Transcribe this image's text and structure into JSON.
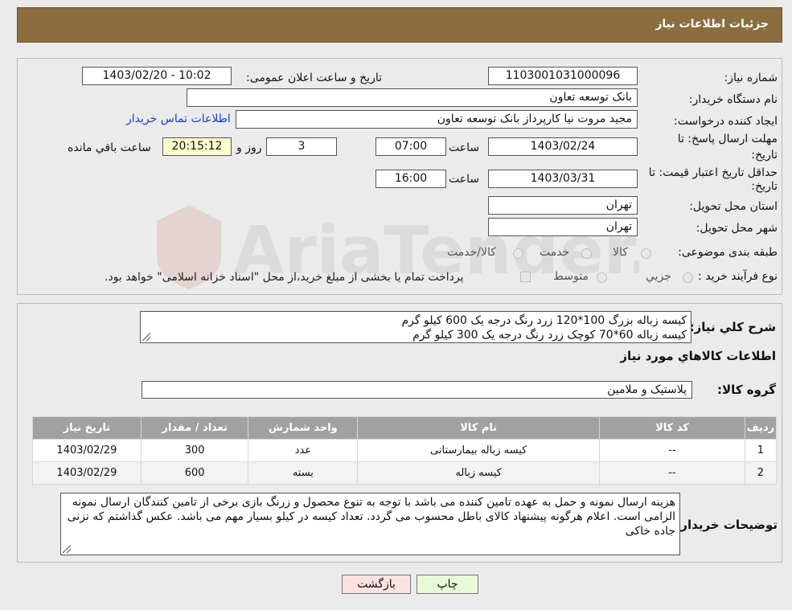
{
  "header": {
    "title": "جزئیات اطلاعات نیاز"
  },
  "fields": {
    "need_number_label": "شماره نیاز:",
    "need_number": "1103001031000096",
    "announce_label": "تاریخ و ساعت اعلان عمومی:",
    "announce_value": "1403/02/20 - 10:02",
    "buyer_org_label": "نام دستگاه خریدار:",
    "buyer_org": "بانک توسعه تعاون",
    "requester_label": "ایجاد کننده درخواست:",
    "requester": "مجید مروت نیا کارپرداز بانک توسعه تعاون",
    "buyer_contact_link": "اطلاعات تماس خریدار",
    "deadline_label_1": "مهلت ارسال پاسخ: تا",
    "deadline_label_2": "تاریخ:",
    "deadline_date": "1403/02/24",
    "time_label": "ساعت",
    "deadline_time": "07:00",
    "days_value": "3",
    "days_label": "روز و",
    "remaining_time": "20:15:12",
    "remaining_label": "ساعت باقي مانده",
    "validity_label_1": "حداقل تاریخ اعتبار قیمت: تا",
    "validity_label_2": "تاریخ:",
    "validity_date": "1403/03/31",
    "validity_time": "16:00",
    "province_label": "استان محل تحویل:",
    "province": "تهران",
    "city_label": "شهر محل تحویل:",
    "city": "تهران",
    "category_label": "طبقه بندی موضوعی:",
    "category_options": [
      "کالا",
      "خدمت",
      "کالا/خدمت"
    ],
    "purchase_type_label": "نوع فرآیند خرید :",
    "purchase_type_options": [
      "جزیي",
      "متوسط"
    ],
    "purchase_note": "پرداخت تمام یا بخشی از مبلغ خرید،از محل \"اسناد خزانه اسلامی\" خواهد بود."
  },
  "watermark": {
    "text": "AriaTender.neT"
  },
  "description": {
    "label": "شرح کلي نياز:",
    "lines": [
      "کیسه زباله بزرگ 100*120 زرد رنگ درجه یک 600 کیلو گرم",
      "کیسه زباله 60*70 کوچک زرد رنگ درجه یک 300 کیلو گرم"
    ]
  },
  "goods": {
    "section_title": "اطلاعات کالاهاي مورد نياز",
    "group_label": "گروه کالا:",
    "group_value": "پلاستیک و ملامین",
    "columns": [
      "رديف",
      "کد کالا",
      "نام کالا",
      "واحد شمارش",
      "تعداد / مقدار",
      "تاریخ نیاز"
    ],
    "rows": [
      [
        "1",
        "--",
        "کیسه زباله بیمارستانی",
        "عدد",
        "300",
        "1403/02/29"
      ],
      [
        "2",
        "--",
        "کیسه زباله",
        "بسته",
        "600",
        "1403/02/29"
      ]
    ]
  },
  "buyer_notes": {
    "label": "توضیحات خریدار:",
    "text": "هزینه ارسال نمونه و حمل به عهده تامین کننده می باشد با توجه به تنوع محصول و زرنگ بازی برخی از تامین کنندگان ارسال نمونه الزامی است. اعلام هرگونه پیشنهاد کالای باطل محسوب می گردد. تعداد کیسه در کیلو بسیار مهم می باشد. عکس گذاشتم که نزنی جاده خاکی"
  },
  "buttons": {
    "print": "چاپ",
    "back": "بازگشت"
  },
  "colors": {
    "header": "#8b6d3f",
    "print_btn": "#e8f9d6",
    "back_btn": "#fbe1e1",
    "link": "#1a3cc6"
  }
}
